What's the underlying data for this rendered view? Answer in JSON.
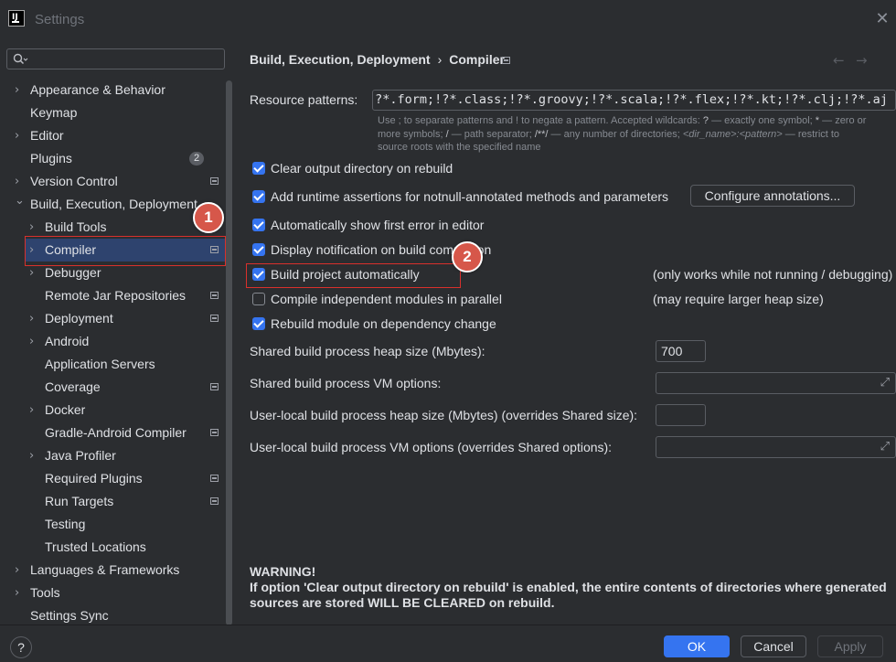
{
  "window": {
    "title": "Settings",
    "app_icon_text": "IJ"
  },
  "search": {
    "placeholder": ""
  },
  "sidebar": {
    "items": [
      {
        "label": "Appearance & Behavior",
        "level": 0,
        "chevron": "right",
        "bold": true
      },
      {
        "label": "Keymap",
        "level": 0,
        "bold": true
      },
      {
        "label": "Editor",
        "level": 0,
        "chevron": "right",
        "bold": true
      },
      {
        "label": "Plugins",
        "level": 0,
        "bold": true,
        "badge": "2"
      },
      {
        "label": "Version Control",
        "level": 0,
        "chevron": "right",
        "bold": true,
        "icon": "project-settings-icon"
      },
      {
        "label": "Build, Execution, Deployment",
        "level": 0,
        "chevron": "down",
        "bold": true
      },
      {
        "label": "Build Tools",
        "level": 1,
        "chevron": "right"
      },
      {
        "label": "Compiler",
        "level": 1,
        "chevron": "right",
        "selected": true,
        "icon": "project-settings-icon"
      },
      {
        "label": "Debugger",
        "level": 1,
        "chevron": "right"
      },
      {
        "label": "Remote Jar Repositories",
        "level": 1,
        "icon": "project-settings-icon"
      },
      {
        "label": "Deployment",
        "level": 1,
        "chevron": "right",
        "icon": "project-settings-icon"
      },
      {
        "label": "Android",
        "level": 1,
        "chevron": "right"
      },
      {
        "label": "Application Servers",
        "level": 1
      },
      {
        "label": "Coverage",
        "level": 1,
        "icon": "project-settings-icon"
      },
      {
        "label": "Docker",
        "level": 1,
        "chevron": "right"
      },
      {
        "label": "Gradle-Android Compiler",
        "level": 1,
        "icon": "project-settings-icon"
      },
      {
        "label": "Java Profiler",
        "level": 1,
        "chevron": "right"
      },
      {
        "label": "Required Plugins",
        "level": 1,
        "icon": "project-settings-icon"
      },
      {
        "label": "Run Targets",
        "level": 1,
        "icon": "project-settings-icon"
      },
      {
        "label": "Testing",
        "level": 1
      },
      {
        "label": "Trusted Locations",
        "level": 1
      },
      {
        "label": "Languages & Frameworks",
        "level": 0,
        "chevron": "right",
        "bold": true
      },
      {
        "label": "Tools",
        "level": 0,
        "chevron": "right",
        "bold": true
      },
      {
        "label": "Settings Sync",
        "level": 0,
        "bold": true
      }
    ]
  },
  "breadcrumb": {
    "parent": "Build, Execution, Deployment",
    "separator": "›",
    "current": "Compiler"
  },
  "compiler": {
    "resource_patterns_label": "Resource patterns:",
    "resource_patterns_value": "!?*.form;!?*.class;!?*.groovy;!?*.scala;!?*.flex;!?*.kt;!?*.clj;!?*.aj",
    "hint_line1_a": "Use ; to separate patterns and ! to negate a pattern. Accepted wildcards: ",
    "hint_line1_b": "?",
    "hint_line1_c": " — exactly one symbol; ",
    "hint_line1_d": "*",
    "hint_line1_e": " — zero or",
    "hint_line2_a": "more symbols; ",
    "hint_line2_b": "/",
    "hint_line2_c": " — path separator; ",
    "hint_line2_d": "/**/",
    "hint_line2_e": " — any number of directories; ",
    "hint_line2_f": "<dir_name>:<pattern>",
    "hint_line2_g": " — restrict to",
    "hint_line3": "source roots with the specified name",
    "options": [
      {
        "label": "Clear output directory on rebuild",
        "checked": true
      },
      {
        "label": "Add runtime assertions for notnull-annotated methods and parameters",
        "checked": true
      },
      {
        "label": "Automatically show first error in editor",
        "checked": true
      },
      {
        "label": "Display notification on build completion",
        "checked": true
      },
      {
        "label": "Build project automatically",
        "checked": true,
        "note": "(only works while not running / debugging)"
      },
      {
        "label": "Compile independent modules in parallel",
        "checked": false,
        "note": "(may require larger heap size)"
      },
      {
        "label": "Rebuild module on dependency change",
        "checked": true
      }
    ],
    "configure_annotations_button": "Configure annotations...",
    "heap_label": "Shared build process heap size (Mbytes):",
    "heap_value": "700",
    "vm_options_label": "Shared build process VM options:",
    "vm_options_value": "",
    "user_heap_label": "User-local build process heap size (Mbytes) (overrides Shared size):",
    "user_heap_value": "",
    "user_vm_label": "User-local build process VM options (overrides Shared options):",
    "user_vm_value": "",
    "warning_title": "WARNING!",
    "warning_line1": "If option 'Clear output directory on rebuild' is enabled, the entire contents of directories where generated",
    "warning_line2": "sources are stored WILL BE CLEARED on rebuild."
  },
  "annotations": {
    "step1": "1",
    "step2": "2",
    "color": "#d9302c"
  },
  "footer": {
    "help": "?",
    "ok": "OK",
    "cancel": "Cancel",
    "apply": "Apply"
  },
  "colors": {
    "background": "#2b2d30",
    "selection": "#2e436e",
    "accent": "#3574f0",
    "text": "#dfe1e5"
  }
}
